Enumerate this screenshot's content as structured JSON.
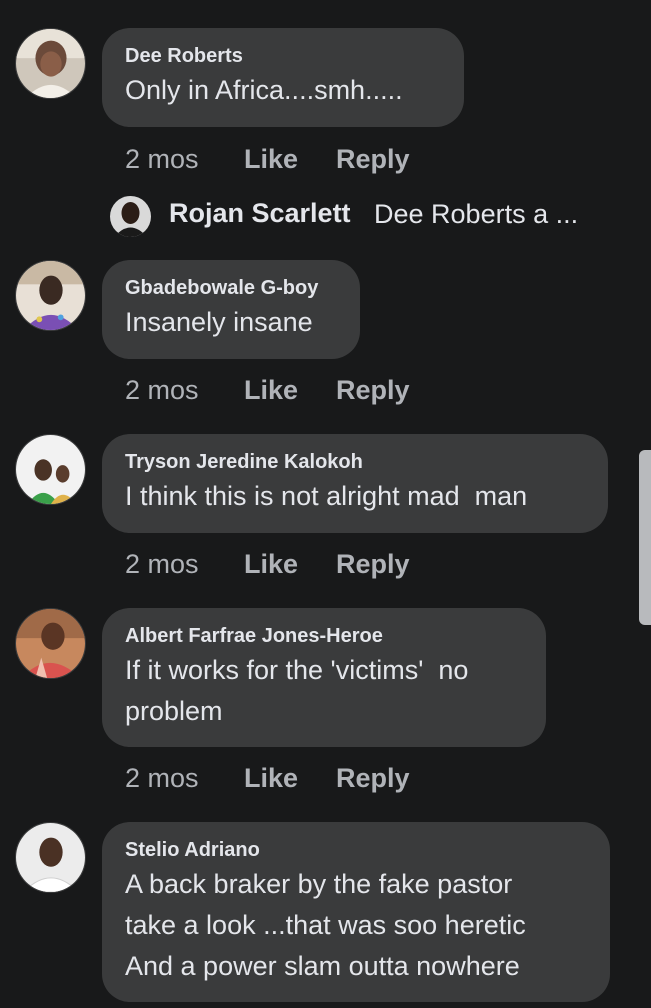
{
  "comments": [
    {
      "author": "Dee Roberts",
      "text": "Only in Africa....smh.....",
      "time": "2 mos",
      "like": "Like",
      "reply": "Reply",
      "avatar_colors": [
        "#c9c1b6",
        "#6b4a3a",
        "#e8e2d8"
      ]
    },
    {
      "author": "Gbadebowale G-boy",
      "text": "Insanely insane",
      "time": "2 mos",
      "like": "Like",
      "reply": "Reply",
      "avatar_colors": [
        "#e8e0d6",
        "#3a2a22",
        "#7a4fb4"
      ]
    },
    {
      "author": "Tryson Jeredine Kalokoh",
      "text": "I think this is not alright mad  man",
      "time": "2 mos",
      "like": "Like",
      "reply": "Reply",
      "avatar_colors": [
        "#f2f2f2",
        "#4a3326",
        "#3aa04a"
      ]
    },
    {
      "author": "Albert Farfrae Jones-Heroe",
      "text": "If it works for the 'victims'  no\nproblem",
      "time": "2 mos",
      "like": "Like",
      "reply": "Reply",
      "avatar_colors": [
        "#c7885e",
        "#5a3524",
        "#d9534f"
      ]
    },
    {
      "author": "Stelio Adriano",
      "text": "A back braker by the fake pastor\ntake a look ...that was soo heretic\nAnd a power slam outta nowhere",
      "avatar_colors": [
        "#ececec",
        "#4a3124",
        "#ffffff"
      ]
    }
  ],
  "reply_preview": {
    "author": "Rojan Scarlett",
    "text": "Dee Roberts a ...",
    "avatar_colors": [
      "#d9d9d9",
      "#2b1d16",
      "#1a1a1a"
    ]
  },
  "colors": {
    "background": "#18191a",
    "bubble": "#3a3b3c",
    "text": "#e4e6eb",
    "secondary": "#b0b3b8"
  }
}
